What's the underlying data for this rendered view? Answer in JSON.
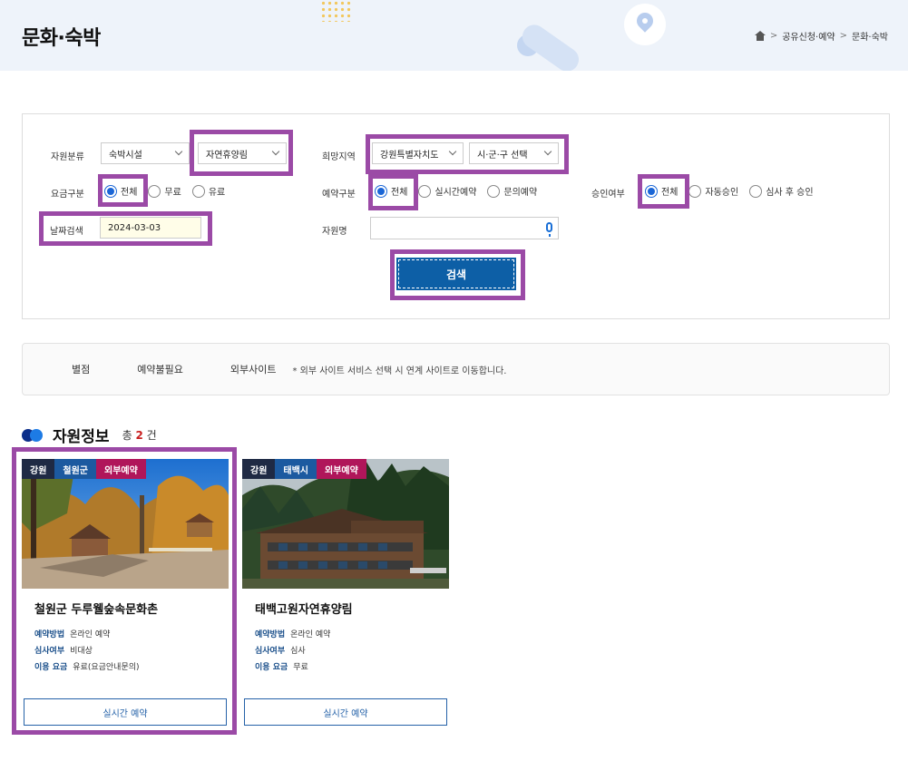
{
  "header": {
    "title": "문화·숙박",
    "breadcrumb": [
      "공유신청·예약",
      "문화·숙박"
    ]
  },
  "filters": {
    "resource_type": {
      "label": "자원분류",
      "category": "숙박시설",
      "sub_category": "자연휴양림"
    },
    "region": {
      "label": "희망지역",
      "province": "강원특별자치도",
      "city": "시·군·구 선택"
    },
    "fee": {
      "label": "요금구분",
      "options": [
        "전체",
        "무료",
        "유료"
      ],
      "selected": "전체"
    },
    "booking": {
      "label": "예약구분",
      "options": [
        "전체",
        "실시간예약",
        "문의예약"
      ],
      "selected": "전체"
    },
    "approval": {
      "label": "승인여부",
      "options": [
        "전체",
        "자동승인",
        "심사 후 승인"
      ],
      "selected": "전체"
    },
    "date": {
      "label": "날짜검색",
      "value": "2024-03-03"
    },
    "name": {
      "label": "자원명",
      "value": ""
    },
    "search_label": "검색"
  },
  "legend": {
    "items": [
      "별점",
      "예약불필요",
      "외부사이트"
    ],
    "note": "* 외부 사이트 서비스 선택 시 연계 사이트로 이동합니다."
  },
  "section": {
    "title": "자원정보",
    "count_prefix": "총",
    "count": "2",
    "count_suffix": "건"
  },
  "cards": [
    {
      "badges": [
        "강원",
        "철원군",
        "외부예약"
      ],
      "title": "철원군 두루웰숲속문화촌",
      "method_key": "예약방법",
      "method_val": "온라인 예약",
      "review_key": "심사여부",
      "review_val": "비대상",
      "fee_key": "이용 요금",
      "fee_val": "유료(요금안내문의)",
      "button": "실시간 예약"
    },
    {
      "badges": [
        "강원",
        "태백시",
        "외부예약"
      ],
      "title": "태백고원자연휴양림",
      "method_key": "예약방법",
      "method_val": "온라인 예약",
      "review_key": "심사여부",
      "review_val": "심사",
      "fee_key": "이용 요금",
      "fee_val": "무료",
      "button": "실시간 예약"
    }
  ],
  "colors": {
    "highlight": "#9b4aa6",
    "primary": "#0d5fa6",
    "badge_region": "#1f2a44",
    "badge_city": "#1c5aa0",
    "badge_external": "#b0165a"
  }
}
